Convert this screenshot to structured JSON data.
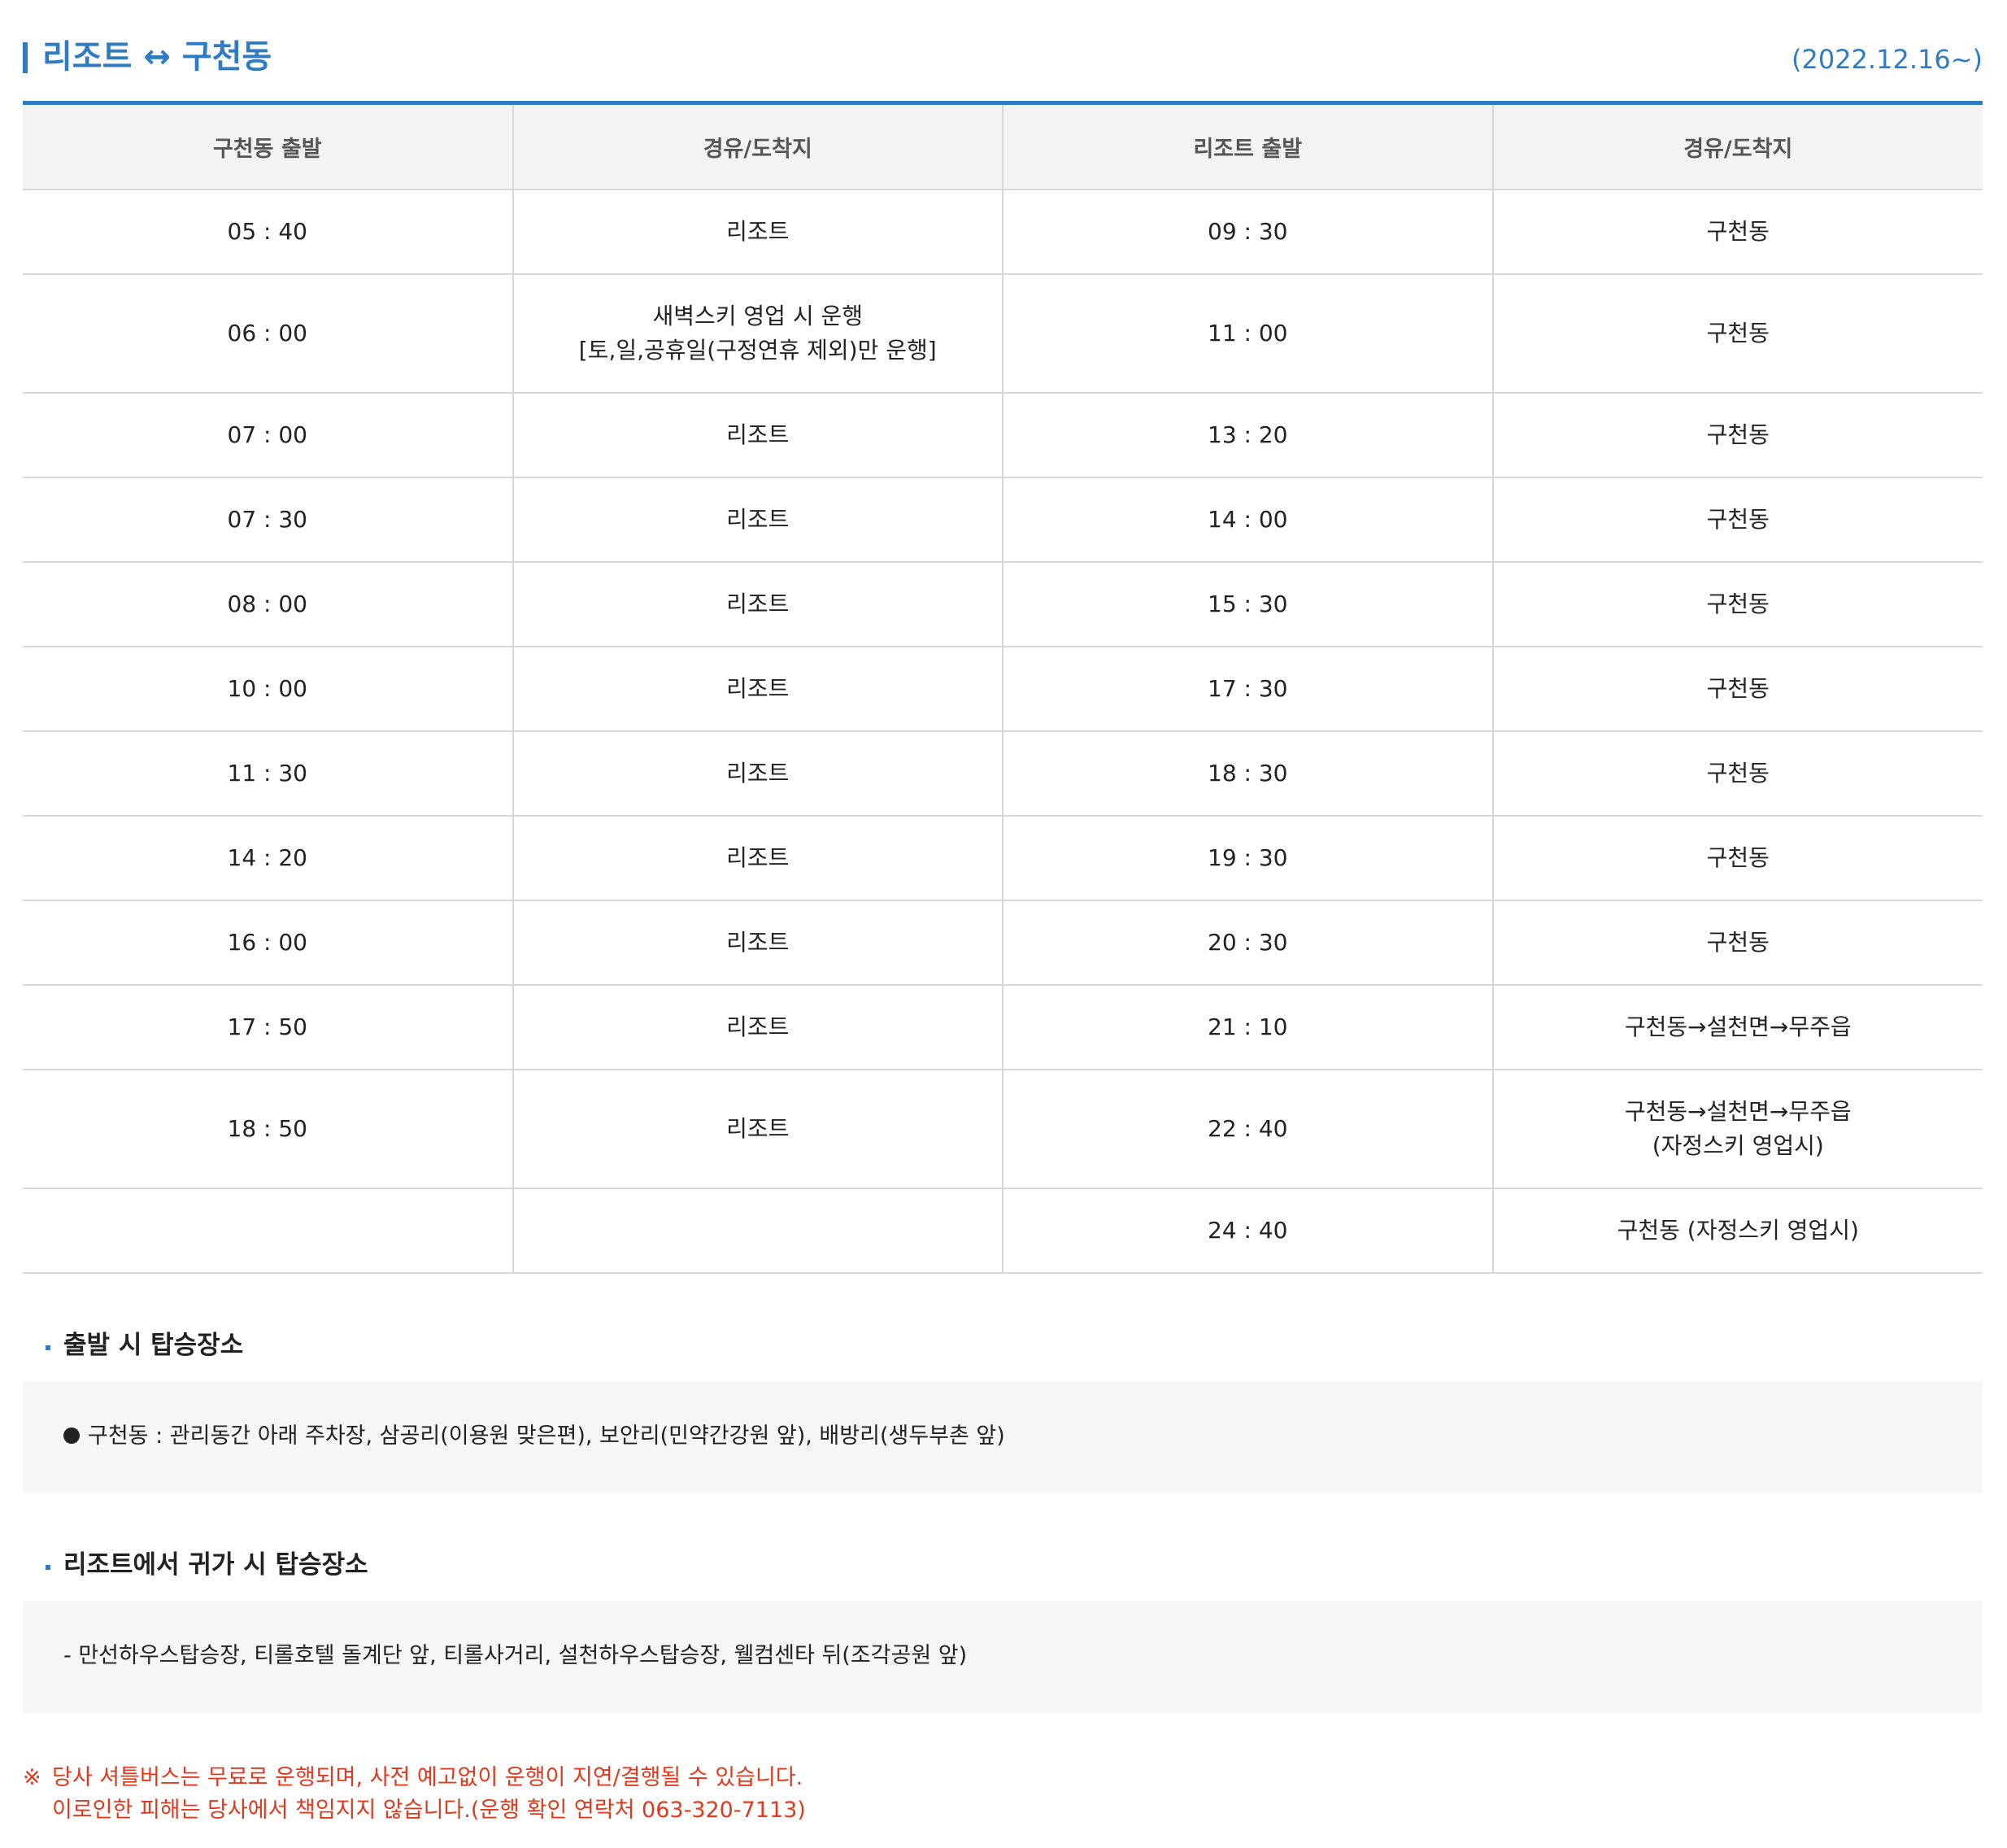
{
  "header": {
    "title": "리조트 ↔ 구천동",
    "date": "(2022.12.16~)"
  },
  "table": {
    "columns": [
      "구천동 출발",
      "경유/도착지",
      "리조트 출발",
      "경유/도착지"
    ],
    "rows": [
      {
        "dep": "05 : 40",
        "via1": [
          "리조트"
        ],
        "ret": "09 : 30",
        "via2": [
          "구천동"
        ]
      },
      {
        "dep": "06 : 00",
        "via1": [
          "새벽스키 영업 시 운행",
          "[토,일,공휴일(구정연휴 제외)만 운행]"
        ],
        "ret": "11 : 00",
        "via2": [
          "구천동"
        ]
      },
      {
        "dep": "07 : 00",
        "via1": [
          "리조트"
        ],
        "ret": "13 : 20",
        "via2": [
          "구천동"
        ]
      },
      {
        "dep": "07 : 30",
        "via1": [
          "리조트"
        ],
        "ret": "14 : 00",
        "via2": [
          "구천동"
        ]
      },
      {
        "dep": "08 : 00",
        "via1": [
          "리조트"
        ],
        "ret": "15 : 30",
        "via2": [
          "구천동"
        ]
      },
      {
        "dep": "10 : 00",
        "via1": [
          "리조트"
        ],
        "ret": "17 : 30",
        "via2": [
          "구천동"
        ]
      },
      {
        "dep": "11 : 30",
        "via1": [
          "리조트"
        ],
        "ret": "18 : 30",
        "via2": [
          "구천동"
        ]
      },
      {
        "dep": "14 : 20",
        "via1": [
          "리조트"
        ],
        "ret": "19 : 30",
        "via2": [
          "구천동"
        ]
      },
      {
        "dep": "16 : 00",
        "via1": [
          "리조트"
        ],
        "ret": "20 : 30",
        "via2": [
          "구천동"
        ]
      },
      {
        "dep": "17 : 50",
        "via1": [
          "리조트"
        ],
        "ret": "21 : 10",
        "via2": [
          "구천동→설천면→무주읍"
        ]
      },
      {
        "dep": "18 : 50",
        "via1": [
          "리조트"
        ],
        "ret": "22 : 40",
        "via2": [
          "구천동→설천면→무주읍",
          "(자정스키 영업시)"
        ]
      },
      {
        "dep": "",
        "via1": [
          ""
        ],
        "ret": "24 : 40",
        "via2": [
          "구천동 (자정스키 영업시)"
        ]
      }
    ]
  },
  "boarding_departure": {
    "title": "출발 시 탑승장소",
    "text": "구천동 : 관리동간 아래 주차장, 삼공리(이용원 맞은편), 보안리(민약간강원 앞), 배방리(생두부촌 앞)"
  },
  "boarding_return": {
    "title": "리조트에서 귀가 시 탑승장소",
    "text": "- 만선하우스탑승장, 티롤호텔 돌계단 앞, 티롤사거리, 설천하우스탑승장, 웰컴센타 뒤(조각공원 앞)"
  },
  "notice": {
    "mark": "※",
    "line1": "당사 셔틀버스는 무료로 운행되며, 사전 예고없이 운행이 지연/결행될 수 있습니다.",
    "line2": "이로인한 피해는 당사에서 책임지지 않습니다.(운행 확인 연락처 063-320-7113)"
  },
  "colors": {
    "accent": "#2f7bc4",
    "notice": "#e03a1e",
    "header_bg": "#f3f3f3",
    "box_bg": "#f6f6f6"
  }
}
